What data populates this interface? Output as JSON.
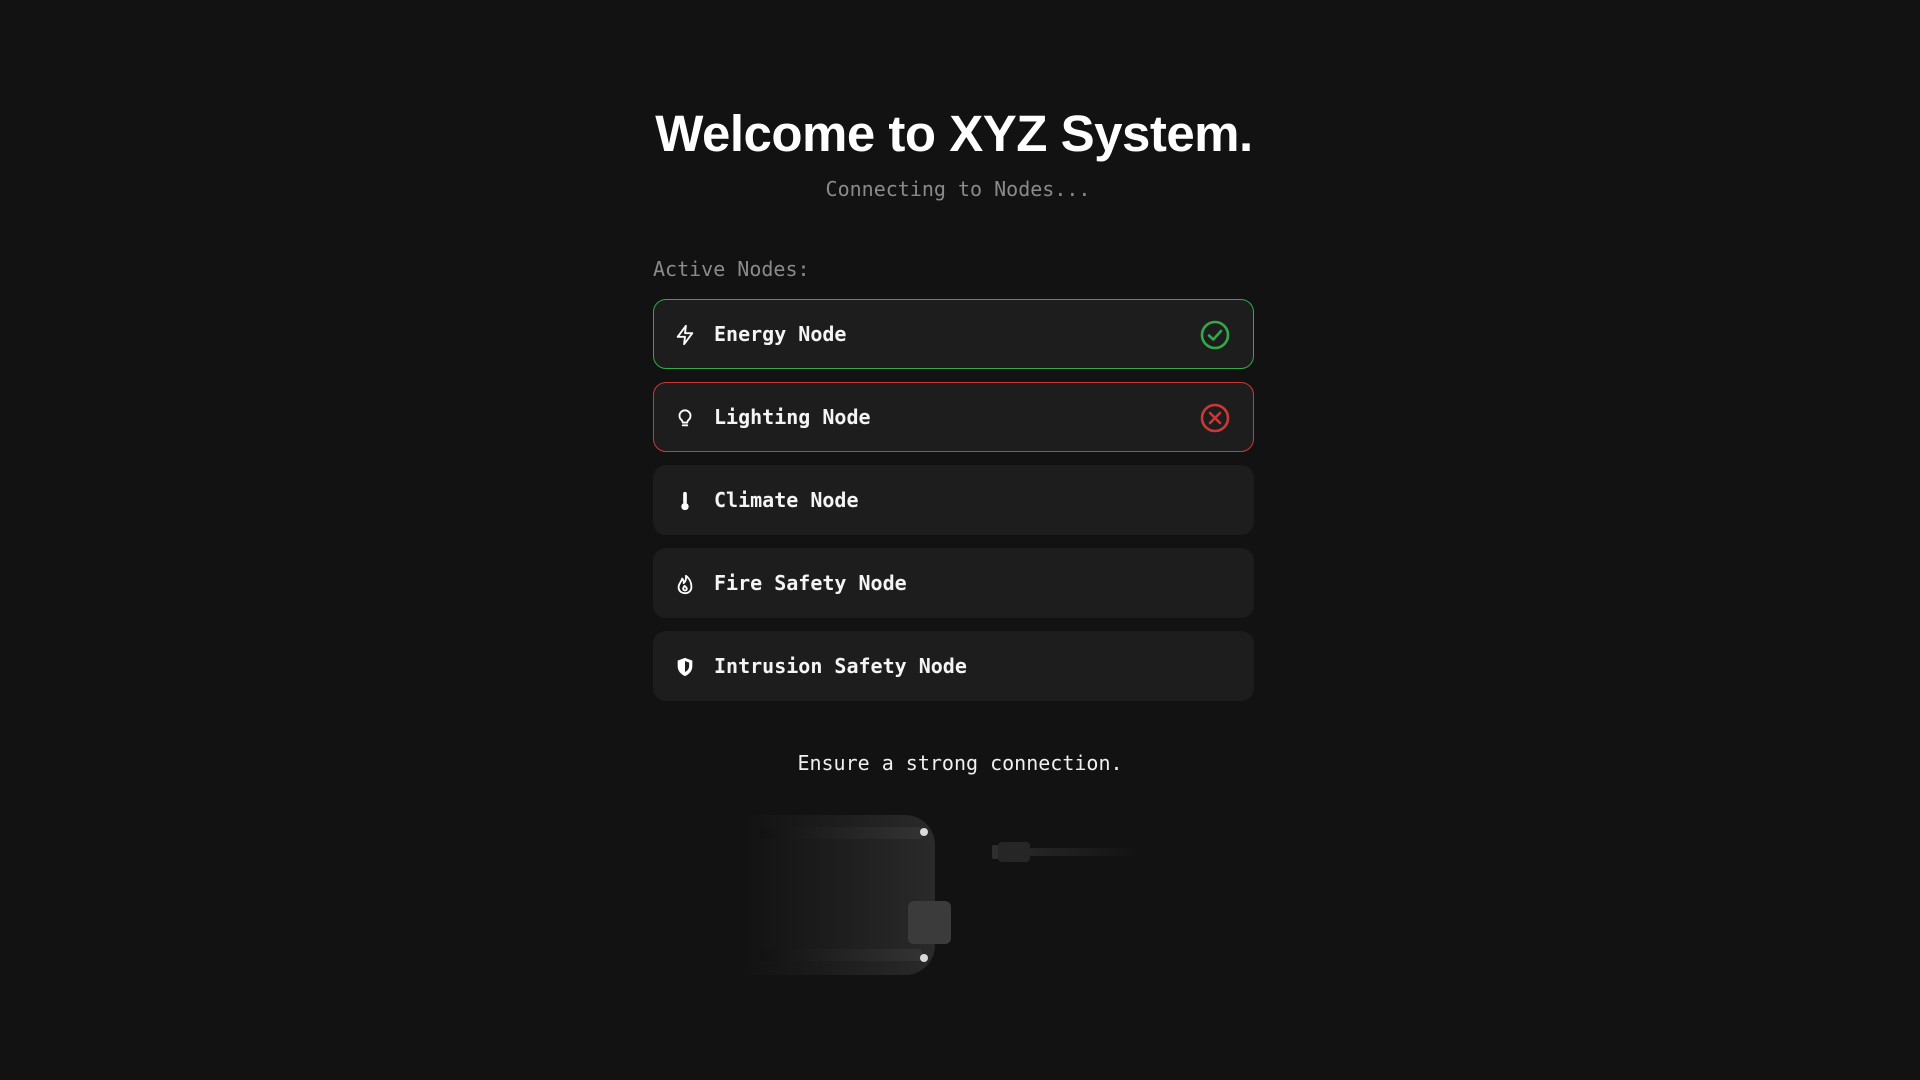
{
  "header": {
    "title": "Welcome to XYZ System.",
    "subtitle": "Connecting to Nodes..."
  },
  "nodes_section": {
    "label": "Active Nodes:",
    "items": [
      {
        "label": "Energy Node",
        "icon": "lightning-bolt-icon",
        "status": "connected"
      },
      {
        "label": "Lighting Node",
        "icon": "lightbulb-icon",
        "status": "failed"
      },
      {
        "label": "Climate Node",
        "icon": "thermometer-icon",
        "status": "pending"
      },
      {
        "label": "Fire Safety Node",
        "icon": "flame-icon",
        "status": "pending"
      },
      {
        "label": "Intrusion Safety Node",
        "icon": "shield-icon",
        "status": "pending"
      }
    ]
  },
  "footer": {
    "note": "Ensure a strong connection."
  },
  "colors": {
    "background": "#121212",
    "card": "#1d1d1d",
    "success": "#32a84a",
    "error": "#cc3838",
    "muted_text": "#8a8a8a"
  }
}
